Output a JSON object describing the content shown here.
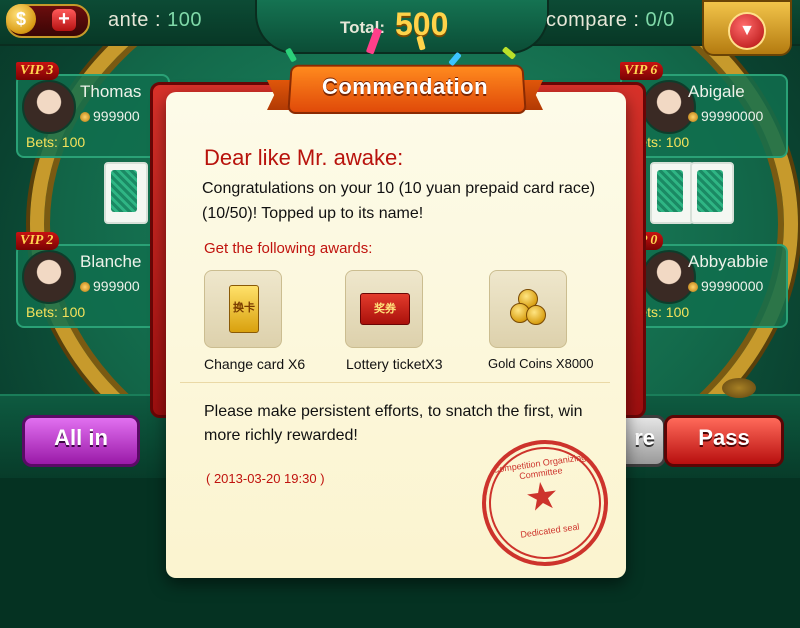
{
  "top_bar": {
    "coin_symbol": "$",
    "plus": "+",
    "ante_label": "ante :",
    "ante_value": "100",
    "total_label": "Total:",
    "total_value": "500",
    "compare_label": "compare :",
    "compare_value": "0/0",
    "menu_arrow": "▼"
  },
  "players": [
    {
      "vip": "VIP 3",
      "name": "Thomas",
      "chips": "999900",
      "bets": "Bets: 100"
    },
    {
      "vip": "VIP 2",
      "name": "Blanche",
      "chips": "999900",
      "bets": "Bets: 100"
    },
    {
      "vip": "VIP 6",
      "name": "Abigale",
      "chips": "99990000",
      "bets": "Bets: 100"
    },
    {
      "vip": "VIP 0",
      "name": "Abbyabbie",
      "chips": "99990000",
      "bets": "Bets: 100"
    }
  ],
  "buttons": {
    "all_in": "All in",
    "compare_partial": "re",
    "pass": "Pass"
  },
  "dialog": {
    "title": "Commendation",
    "greeting": "Dear like Mr. awake:",
    "message": "Congratulations on your 10 (10 yuan prepaid card race)  (10/50)! Topped up to its name!",
    "awards_heading": "Get the following awards:",
    "awards": [
      {
        "icon": "change-card-icon",
        "glyph": "换卡",
        "label": "Change card X6"
      },
      {
        "icon": "lottery-ticket-icon",
        "glyph": "奖券",
        "label": "Lottery ticketX3"
      },
      {
        "icon": "gold-coins-icon",
        "glyph": "",
        "label": "Gold Coins X8000"
      }
    ],
    "closing": "Please make persistent efforts, to snatch the first, win more richly rewarded!",
    "date": "( 2013-03-20    19:30 )",
    "seal_org": "Competition Organizing Committee",
    "seal_sub": "Dedicated seal",
    "seal_star": "★"
  },
  "colors": {
    "accent_red": "#b8120c",
    "gold": "#ffd34a",
    "felt_green": "#136a4b",
    "bets_yellow": "#f5e25b"
  }
}
